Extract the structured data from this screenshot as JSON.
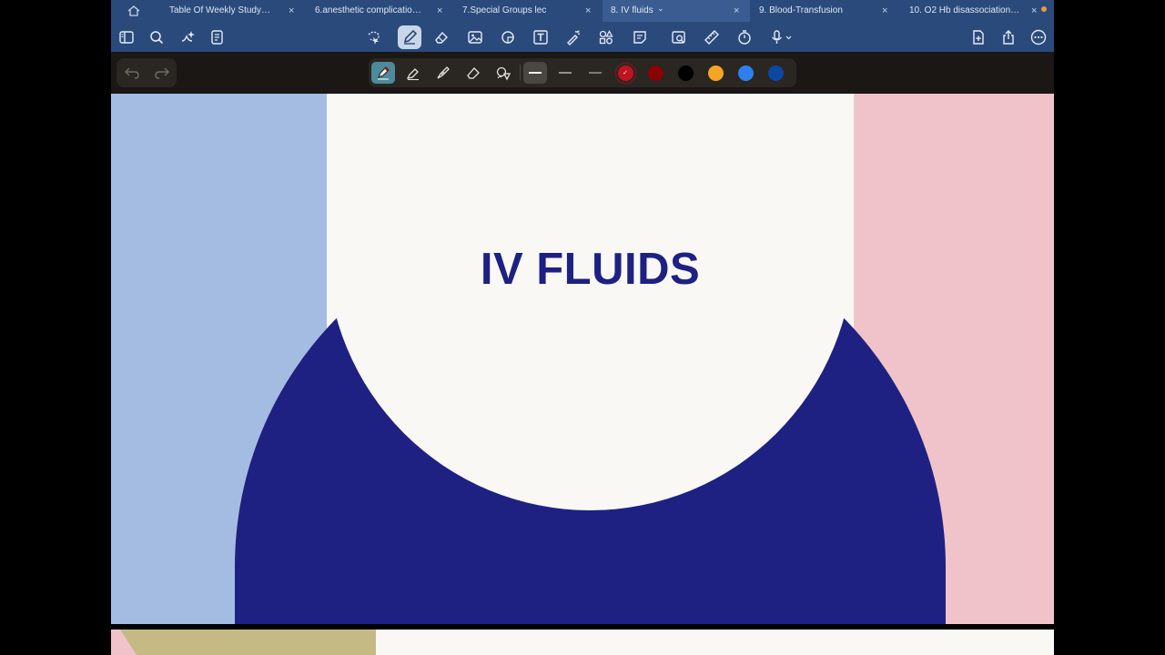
{
  "tabs": [
    {
      "label": "Table Of Weekly Study…",
      "active": false
    },
    {
      "label": "6.anesthetic complicatio…",
      "active": false
    },
    {
      "label": "7.Special Groups lec",
      "active": false
    },
    {
      "label": "8. IV fluids",
      "active": true
    },
    {
      "label": "9. Blood-Transfusion",
      "active": false
    },
    {
      "label": "10. O2 Hb disassociation…",
      "active": false
    }
  ],
  "tab_close_glyph": "×",
  "tab_chevron_glyph": "⌄",
  "toolbar_icons": {
    "left": [
      "sidebar-icon",
      "search-icon",
      "ai-sparkle-icon",
      "outline-icon"
    ],
    "center": [
      "lasso-icon",
      "pen-icon",
      "eraser-icon",
      "image-icon",
      "shape-icon",
      "text-box-icon",
      "laser-pointer-icon",
      "elements-icon",
      "sticky-note-icon",
      "scan-icon",
      "ruler-icon",
      "timer-icon",
      "microphone-icon"
    ],
    "right": [
      "add-page-icon",
      "share-icon",
      "more-icon"
    ]
  },
  "pen_tools": [
    "fountain-pen-icon",
    "highlighter-icon",
    "brush-pen-icon",
    "eraser-tool-icon",
    "shapes-tool-icon"
  ],
  "colors": {
    "swatches": [
      "#c1121f",
      "#8b0000",
      "#000000",
      "#f5a623",
      "#2f80ed",
      "#0d47a1"
    ],
    "selected_swatch": "#c1121f",
    "tab_bar": "#2a4a7c",
    "subbar": "#1a1714",
    "slide_blue": "#a4bce2",
    "slide_pink": "#f0c3ca",
    "slide_navy": "#1e2182",
    "slide_cream": "#faf8f4"
  },
  "slide": {
    "title": "IV FLUIDS"
  }
}
